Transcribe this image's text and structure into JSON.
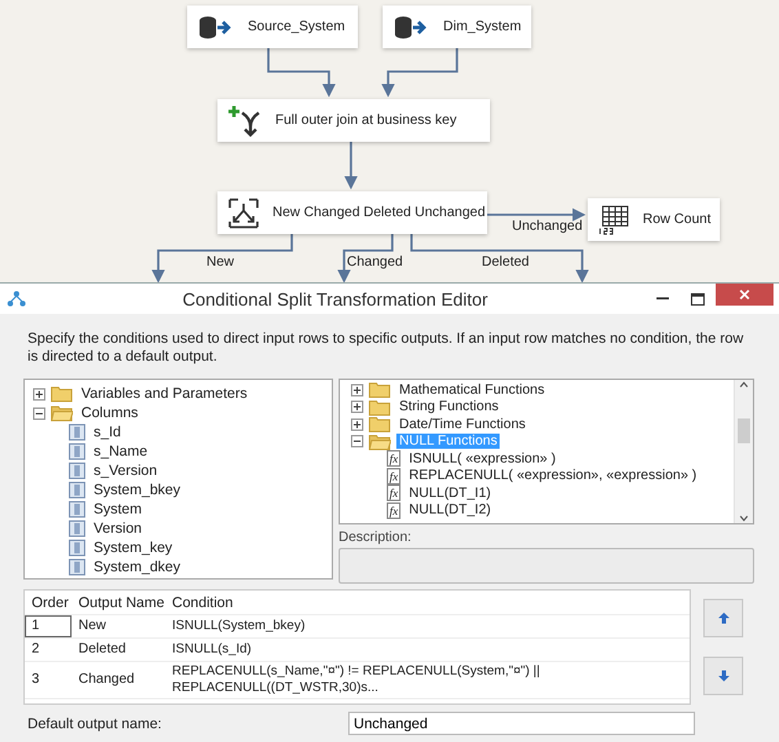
{
  "canvas": {
    "nodes": [
      {
        "label": "Source_System",
        "kind": "source"
      },
      {
        "label": "Dim_System",
        "kind": "source"
      },
      {
        "label": "Full outer join at business key",
        "kind": "merge_join"
      },
      {
        "label": "New Changed Deleted Unchanged",
        "kind": "conditional_split"
      },
      {
        "label": "Row Count",
        "kind": "row_count"
      }
    ],
    "paths": [
      {
        "label": "Unchanged"
      },
      {
        "label": "New"
      },
      {
        "label": "Changed"
      },
      {
        "label": "Deleted"
      }
    ]
  },
  "dialog": {
    "title": "Conditional Split Transformation Editor",
    "instructions": "Specify the conditions used to direct input rows to specific outputs. If an input row matches no condition, the row is directed to a default output.",
    "input_tree": [
      {
        "label": "Variables and Parameters",
        "kind": "folder",
        "expanded": false
      },
      {
        "label": "Columns",
        "kind": "folder",
        "expanded": true,
        "children": [
          {
            "label": "s_Id",
            "kind": "column"
          },
          {
            "label": "s_Name",
            "kind": "column"
          },
          {
            "label": "s_Version",
            "kind": "column"
          },
          {
            "label": "System_bkey",
            "kind": "column"
          },
          {
            "label": "System",
            "kind": "column"
          },
          {
            "label": "Version",
            "kind": "column"
          },
          {
            "label": "System_key",
            "kind": "column"
          },
          {
            "label": "System_dkey",
            "kind": "column"
          }
        ]
      }
    ],
    "function_tree": [
      {
        "label": "Mathematical Functions",
        "kind": "folder",
        "expanded": false,
        "selected": false
      },
      {
        "label": "String Functions",
        "kind": "folder",
        "expanded": false,
        "selected": false
      },
      {
        "label": "Date/Time Functions",
        "kind": "folder",
        "expanded": false,
        "selected": false
      },
      {
        "label": "NULL Functions",
        "kind": "folder",
        "expanded": true,
        "selected": true,
        "children": [
          {
            "label": "ISNULL( «expression» )",
            "kind": "function",
            "icon": "fx",
            "selected": false
          },
          {
            "label": "REPLACENULL( «expression», «expression» )",
            "kind": "function",
            "icon": "fx",
            "selected": false
          },
          {
            "label": "NULL(DT_I1)",
            "kind": "function",
            "icon": "fx",
            "selected": false
          },
          {
            "label": "NULL(DT_I2)",
            "kind": "function",
            "icon": "fx",
            "selected": false
          }
        ]
      }
    ],
    "description_label": "Description:",
    "table": {
      "columns": [
        "Order",
        "Output Name",
        "Condition"
      ],
      "rows": [
        {
          "order": "1",
          "output_name": "New",
          "condition": "ISNULL(System_bkey)"
        },
        {
          "order": "2",
          "output_name": "Deleted",
          "condition": "ISNULL(s_Id)"
        },
        {
          "order": "3",
          "output_name": "Changed",
          "condition": "REPLACENULL(s_Name,\"¤\") != REPLACENULL(System,\"¤\") || REPLACENULL((DT_WSTR,30)s..."
        }
      ]
    },
    "default_output": {
      "label": "Default output name:",
      "value": "Unchanged"
    }
  }
}
